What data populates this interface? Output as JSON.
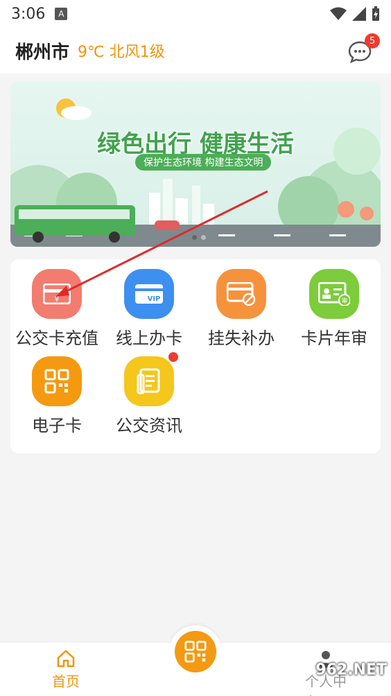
{
  "status": {
    "time": "3:06",
    "a_icon": "A"
  },
  "header": {
    "city": "郴州市",
    "weather": "9℃  北风1级",
    "badge": "5"
  },
  "banner": {
    "title": "绿色出行 健康生活",
    "subtitle": "保护生态环境 构建生态文明",
    "colors": {
      "title": "#3fa34d",
      "bus": "#4cae58"
    }
  },
  "services": [
    {
      "label": "公交卡充值",
      "icon": "card-recharge-icon",
      "color": "#f27c6f"
    },
    {
      "label": "线上办卡",
      "icon": "vip-card-icon",
      "color": "#3d8ff0"
    },
    {
      "label": "挂失补办",
      "icon": "card-cancel-icon",
      "color": "#f6923c"
    },
    {
      "label": "卡片年审",
      "icon": "id-card-icon",
      "color": "#7ccc3b"
    },
    {
      "label": "电子卡",
      "icon": "qr-code-icon",
      "color": "#f59a10"
    },
    {
      "label": "公交资讯",
      "icon": "news-icon",
      "color": "#f5c61b"
    }
  ],
  "tabbar": {
    "home": "首页",
    "me": "个人中心"
  },
  "watermark": "962.NET",
  "accent": "#f0950b"
}
